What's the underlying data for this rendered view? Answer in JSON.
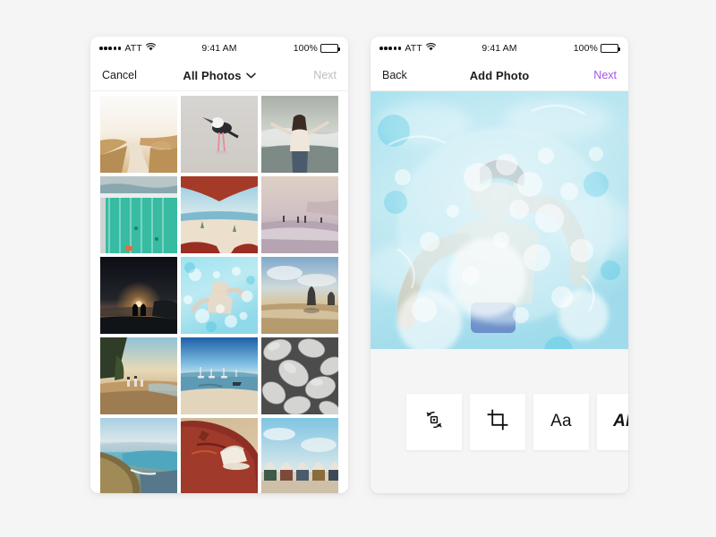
{
  "background_color": "#f5f5f5",
  "accent_color": "#a355e8",
  "screens": [
    {
      "id": "photo-picker",
      "status_bar": {
        "signal_dots": 5,
        "carrier": "ATT",
        "wifi_icon": "wifi-icon",
        "time": "9:41 AM",
        "battery_percent": "100%",
        "battery_icon": "battery-full-icon"
      },
      "nav": {
        "left_label": "Cancel",
        "title": "All Photos",
        "title_chevron_icon": "chevron-down-icon",
        "right_label": "Next",
        "right_state": "disabled"
      },
      "grid": {
        "columns": 3,
        "photos": [
          {
            "id": "p1",
            "caption": "Sandy dune path at sunset",
            "art": "dune-path"
          },
          {
            "id": "p2",
            "caption": "Black-winged stilt bird on sand",
            "art": "stilt-bird"
          },
          {
            "id": "p3",
            "caption": "Woman with arms outstretched at surf",
            "art": "woman-surf"
          },
          {
            "id": "p4",
            "caption": "Ocean swimming pool from above",
            "art": "ocean-pool"
          },
          {
            "id": "p5",
            "caption": "Beach viewed from inside a tent",
            "art": "tent-beach"
          },
          {
            "id": "p6",
            "caption": "Hazy pink shoreline with figures",
            "art": "hazy-shore"
          },
          {
            "id": "p7",
            "caption": "Sunset silhouette of two people",
            "art": "sunset-couple"
          },
          {
            "id": "p8",
            "caption": "Swimmer underwater with bubbles",
            "art": "swimmer"
          },
          {
            "id": "p9",
            "caption": "Sea stack at golden hour",
            "art": "sea-stack"
          },
          {
            "id": "p10",
            "caption": "Family walking on forest beach",
            "art": "forest-beach"
          },
          {
            "id": "p11",
            "caption": "Sailboats moored in blue bay",
            "art": "sailboats"
          },
          {
            "id": "p12",
            "caption": "Grey pebbles close-up",
            "art": "pebbles"
          },
          {
            "id": "p13",
            "caption": "Coastal cliff overlooking bay",
            "art": "cliff-bay"
          },
          {
            "id": "p14",
            "caption": "Sneakers and board on sand",
            "art": "sneakers-sand"
          },
          {
            "id": "p15",
            "caption": "Row of beach huts under blue sky",
            "art": "beach-huts"
          }
        ]
      }
    },
    {
      "id": "photo-editor",
      "status_bar": {
        "signal_dots": 5,
        "carrier": "ATT",
        "wifi_icon": "wifi-icon",
        "time": "9:41 AM",
        "battery_percent": "100%",
        "battery_icon": "battery-full-icon"
      },
      "nav": {
        "left_label": "Back",
        "title": "Add Photo",
        "right_label": "Next",
        "right_state": "enabled"
      },
      "hero": {
        "caption": "Swimmer underwater surrounded by bubbles",
        "art": "swimmer-hero"
      },
      "tools": [
        {
          "id": "rotate",
          "icon": "rotate-icon",
          "label": ""
        },
        {
          "id": "crop",
          "icon": "crop-icon",
          "label": ""
        },
        {
          "id": "text",
          "icon": "text-icon",
          "label": "Aa"
        },
        {
          "id": "style",
          "icon": "text-style-icon",
          "label": "Ab"
        }
      ]
    }
  ]
}
